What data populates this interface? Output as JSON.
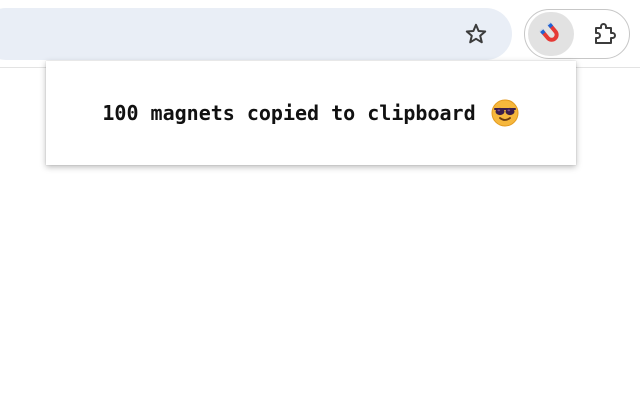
{
  "toolbar": {
    "star_icon": "star-outline-icon",
    "extension_icon": "magnet-icon",
    "extensions_menu_icon": "puzzle-piece-icon"
  },
  "popup": {
    "message": "100 magnets copied to clipboard",
    "emoji": "smiling-face-with-sunglasses"
  },
  "colors": {
    "omnibox_bg": "#e9eef6",
    "active_ext_bg": "#e2e2e2",
    "magnet_red": "#e53935",
    "magnet_blue": "#1e63d6"
  }
}
